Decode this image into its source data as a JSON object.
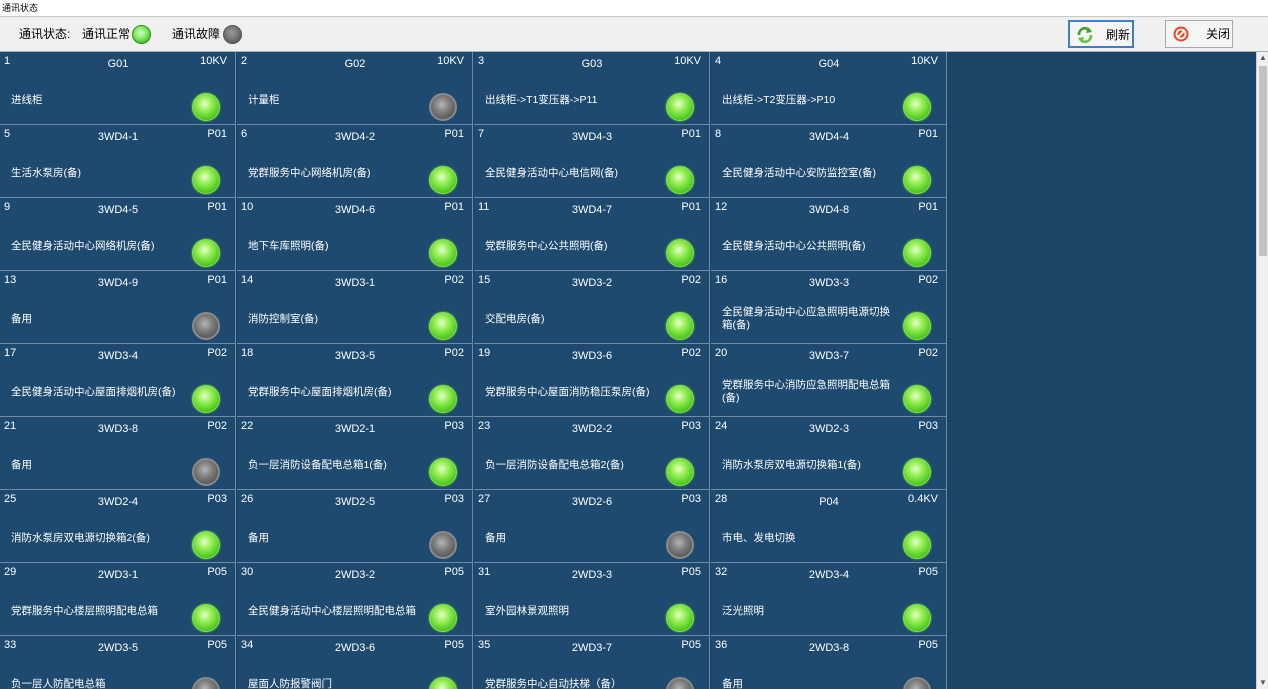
{
  "window": {
    "title": "通讯状态"
  },
  "toolbar": {
    "status_label": "通讯状态:",
    "normal_label": "通讯正常",
    "fault_label": "通讯故障",
    "refresh_label": "刷新",
    "close_label": "关闭"
  },
  "colors": {
    "panel_bg": "#1b4466",
    "cell_bg": "#1d4a6e",
    "led_ok": "#4ecb1e",
    "led_fault": "#6e6e6e"
  },
  "cells": [
    {
      "num": "1",
      "code": "G01",
      "volt": "10KV",
      "desc": "进线柜",
      "status": "ok"
    },
    {
      "num": "2",
      "code": "G02",
      "volt": "10KV",
      "desc": "计量柜",
      "status": "fault"
    },
    {
      "num": "3",
      "code": "G03",
      "volt": "10KV",
      "desc": "出线柜->T1变压器->P11",
      "status": "ok"
    },
    {
      "num": "4",
      "code": "G04",
      "volt": "10KV",
      "desc": "出线柜->T2变压器->P10",
      "status": "ok"
    },
    {
      "num": "5",
      "code": "3WD4-1",
      "volt": "P01",
      "desc": "生活水泵房(备)",
      "status": "ok"
    },
    {
      "num": "6",
      "code": "3WD4-2",
      "volt": "P01",
      "desc": "党群服务中心网络机房(备)",
      "status": "ok"
    },
    {
      "num": "7",
      "code": "3WD4-3",
      "volt": "P01",
      "desc": "全民健身活动中心电信网(备)",
      "status": "ok"
    },
    {
      "num": "8",
      "code": "3WD4-4",
      "volt": "P01",
      "desc": "全民健身活动中心安防监控室(备)",
      "status": "ok"
    },
    {
      "num": "9",
      "code": "3WD4-5",
      "volt": "P01",
      "desc": "全民健身活动中心网络机房(备)",
      "status": "ok"
    },
    {
      "num": "10",
      "code": "3WD4-6",
      "volt": "P01",
      "desc": "地下车库照明(备)",
      "status": "ok"
    },
    {
      "num": "11",
      "code": "3WD4-7",
      "volt": "P01",
      "desc": "党群服务中心公共照明(备)",
      "status": "ok"
    },
    {
      "num": "12",
      "code": "3WD4-8",
      "volt": "P01",
      "desc": "全民健身活动中心公共照明(备)",
      "status": "ok"
    },
    {
      "num": "13",
      "code": "3WD4-9",
      "volt": "P01",
      "desc": "备用",
      "status": "fault"
    },
    {
      "num": "14",
      "code": "3WD3-1",
      "volt": "P02",
      "desc": "消防控制室(备)",
      "status": "ok"
    },
    {
      "num": "15",
      "code": "3WD3-2",
      "volt": "P02",
      "desc": "交配电房(备)",
      "status": "ok"
    },
    {
      "num": "16",
      "code": "3WD3-3",
      "volt": "P02",
      "desc": "全民健身活动中心应急照明电源切换箱(备)",
      "status": "ok"
    },
    {
      "num": "17",
      "code": "3WD3-4",
      "volt": "P02",
      "desc": "全民健身活动中心屋面排烟机房(备)",
      "status": "ok"
    },
    {
      "num": "18",
      "code": "3WD3-5",
      "volt": "P02",
      "desc": "党群服务中心屋面排烟机房(备)",
      "status": "ok"
    },
    {
      "num": "19",
      "code": "3WD3-6",
      "volt": "P02",
      "desc": "党群服务中心屋面消防稳压泵房(备)",
      "status": "ok"
    },
    {
      "num": "20",
      "code": "3WD3-7",
      "volt": "P02",
      "desc": "党群服务中心消防应急照明配电总箱(备)",
      "status": "ok"
    },
    {
      "num": "21",
      "code": "3WD3-8",
      "volt": "P02",
      "desc": "备用",
      "status": "fault"
    },
    {
      "num": "22",
      "code": "3WD2-1",
      "volt": "P03",
      "desc": "负一层消防设备配电总箱1(备)",
      "status": "ok"
    },
    {
      "num": "23",
      "code": "3WD2-2",
      "volt": "P03",
      "desc": "负一层消防设备配电总箱2(备)",
      "status": "ok"
    },
    {
      "num": "24",
      "code": "3WD2-3",
      "volt": "P03",
      "desc": "消防水泵房双电源切换箱1(备)",
      "status": "ok"
    },
    {
      "num": "25",
      "code": "3WD2-4",
      "volt": "P03",
      "desc": "消防水泵房双电源切换箱2(备)",
      "status": "ok"
    },
    {
      "num": "26",
      "code": "3WD2-5",
      "volt": "P03",
      "desc": "备用",
      "status": "fault"
    },
    {
      "num": "27",
      "code": "3WD2-6",
      "volt": "P03",
      "desc": "备用",
      "status": "fault"
    },
    {
      "num": "28",
      "code": "P04",
      "volt": "0.4KV",
      "desc": "市电、发电切换",
      "status": "ok"
    },
    {
      "num": "29",
      "code": "2WD3-1",
      "volt": "P05",
      "desc": "党群服务中心楼层照明配电总箱",
      "status": "ok"
    },
    {
      "num": "30",
      "code": "2WD3-2",
      "volt": "P05",
      "desc": "全民健身活动中心楼层照明配电总箱",
      "status": "ok"
    },
    {
      "num": "31",
      "code": "2WD3-3",
      "volt": "P05",
      "desc": "室外园林景观照明",
      "status": "ok"
    },
    {
      "num": "32",
      "code": "2WD3-4",
      "volt": "P05",
      "desc": "泛光照明",
      "status": "ok"
    },
    {
      "num": "33",
      "code": "2WD3-5",
      "volt": "P05",
      "desc": "负一层人防配电总箱",
      "status": "fault"
    },
    {
      "num": "34",
      "code": "2WD3-6",
      "volt": "P05",
      "desc": "屋面人防报警阀门",
      "status": "ok"
    },
    {
      "num": "35",
      "code": "2WD3-7",
      "volt": "P05",
      "desc": "党群服务中心自动扶梯（备）",
      "status": "fault"
    },
    {
      "num": "36",
      "code": "2WD3-8",
      "volt": "P05",
      "desc": "备用",
      "status": "fault"
    }
  ]
}
